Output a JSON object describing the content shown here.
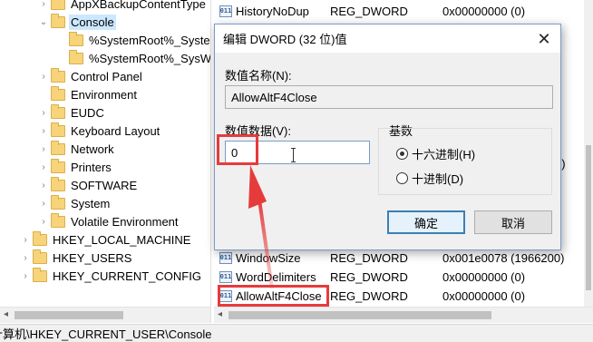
{
  "tree": {
    "items": [
      {
        "label": "AppXBackupContentType",
        "expand": ">",
        "selected": false
      },
      {
        "label": "Console",
        "expand": "v",
        "selected": true
      },
      {
        "label": "%SystemRoot%_System",
        "expand": "",
        "selected": false
      },
      {
        "label": "%SystemRoot%_SysWC",
        "expand": "",
        "selected": false
      },
      {
        "label": "Control Panel",
        "expand": ">",
        "selected": false
      },
      {
        "label": "Environment",
        "expand": "",
        "selected": false
      },
      {
        "label": "EUDC",
        "expand": ">",
        "selected": false
      },
      {
        "label": "Keyboard Layout",
        "expand": ">",
        "selected": false
      },
      {
        "label": "Network",
        "expand": ">",
        "selected": false
      },
      {
        "label": "Printers",
        "expand": ">",
        "selected": false
      },
      {
        "label": "SOFTWARE",
        "expand": ">",
        "selected": false
      },
      {
        "label": "System",
        "expand": ">",
        "selected": false
      },
      {
        "label": "Volatile Environment",
        "expand": ">",
        "selected": false
      },
      {
        "label": "HKEY_LOCAL_MACHINE",
        "expand": ">",
        "selected": false
      },
      {
        "label": "HKEY_USERS",
        "expand": ">",
        "selected": false
      },
      {
        "label": "HKEY_CURRENT_CONFIG",
        "expand": ">",
        "selected": false
      }
    ]
  },
  "list": {
    "rows": [
      {
        "name": "HistoryNoDup",
        "type": "REG_DWORD",
        "data": "0x00000000 (0)"
      },
      {
        "name": "WindowSize",
        "type": "REG_DWORD",
        "data": "0x001e0078 (1966200)"
      },
      {
        "name": "WordDelimiters",
        "type": "REG_DWORD",
        "data": "0x00000000 (0)"
      },
      {
        "name": "AllowAltF4Close",
        "type": "REG_DWORD",
        "data": "0x00000000 (0)"
      }
    ],
    "partial_value": "5)"
  },
  "statusbar": {
    "path": "计算机\\HKEY_CURRENT_USER\\Console"
  },
  "dialog": {
    "title": "编辑 DWORD (32 位)值",
    "close_glyph": "✕",
    "name_label": "数值名称(N):",
    "name_value": "AllowAltF4Close",
    "data_label": "数值数据(V):",
    "data_value": "0",
    "base_label": "基数",
    "base_options": [
      {
        "label": "十六进制(H)",
        "selected": true
      },
      {
        "label": "十进制(D)",
        "selected": false
      }
    ],
    "ok_label": "确定",
    "cancel_label": "取消"
  },
  "annotations": {
    "color": "#e63b3b"
  }
}
